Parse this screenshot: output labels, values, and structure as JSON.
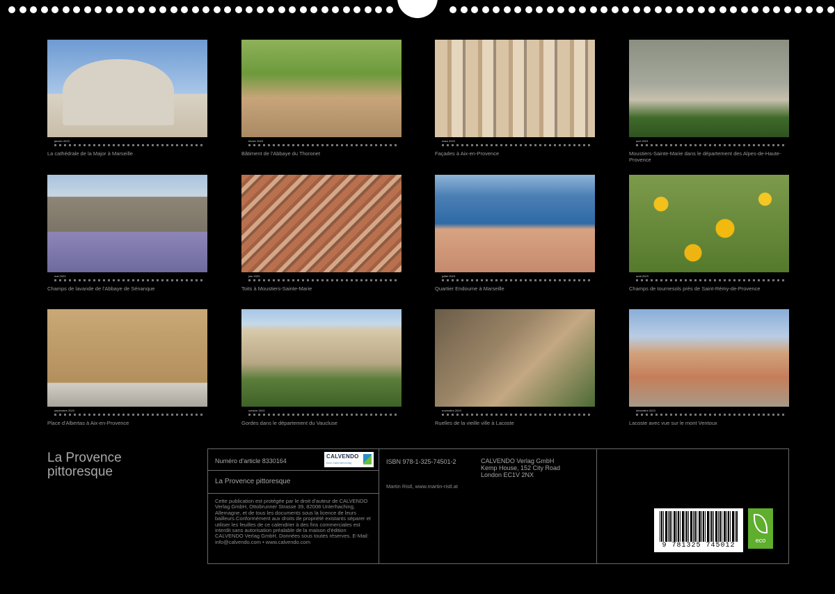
{
  "months": [
    {
      "label": "janvier 2023",
      "caption": "La cathédrale de la Major à Marseille"
    },
    {
      "label": "février 2023",
      "caption": "Bâtiment de l'Abbaye du Thoronet"
    },
    {
      "label": "mars 2023",
      "caption": "Façades à Aix-en-Provence"
    },
    {
      "label": "avril 2023",
      "caption": "Moustiers-Sainte-Marie dans le département des Alpes-de-Haute-Provence"
    },
    {
      "label": "mai 2023",
      "caption": "Champs de lavande de l'Abbaye de Sénanque"
    },
    {
      "label": "juin 2023",
      "caption": "Toits à Moustiers-Sainte-Marie"
    },
    {
      "label": "juillet 2023",
      "caption": "Quartier Endoume à Marseille"
    },
    {
      "label": "août 2023",
      "caption": "Champs de tournesols près de Saint-Rémy-de-Provence"
    },
    {
      "label": "septembre 2023",
      "caption": "Place d'Albertas à Aix-en-Provence"
    },
    {
      "label": "octobre 2023",
      "caption": "Gordes dans le département du Vaucluse"
    },
    {
      "label": "novembre 2023",
      "caption": "Ruelles de la vieille ville à Lacoste"
    },
    {
      "label": "décembre 2023",
      "caption": "Lacoste avec vue sur le mont Ventoux"
    }
  ],
  "title_line1": "La Provence",
  "title_line2": "pittoresque",
  "info": {
    "article": "Numéro d'article 8330164",
    "logo_text": "CALVENDO",
    "logo_sub": "Bon! Kalenderverlag",
    "subtitle": "La Provence pittoresque",
    "legal": "Cette publication est protégée par le droit d'auteur de CALVENDO Verlag GmbH, Ottobrunner Strasse 39, 82008 Unterhaching, Allemagne, et de tous les documents sous la licence de leurs bailleurs.Conformément aux droits de propriété existants séparer et utiliser les feuilles de ce calendrier à des fins commerciales est interdit sans autorisation préalable de la maison d'édition CALVENDO Verlag GmbH. Données sous toutes réserves. E-Mail: info@calvendo.com • www.calvendo.com",
    "isbn": "ISBN 978-1-325-74501-2",
    "publisher_1": "CALVENDO Verlag GmbH",
    "publisher_2": "Kemp House, 152 City Road",
    "publisher_3": "London EC1V 2NX",
    "author": "Martin Ristl, www.martin-ristl.at",
    "barcode": "9 781325 745012",
    "eco": "eco"
  }
}
